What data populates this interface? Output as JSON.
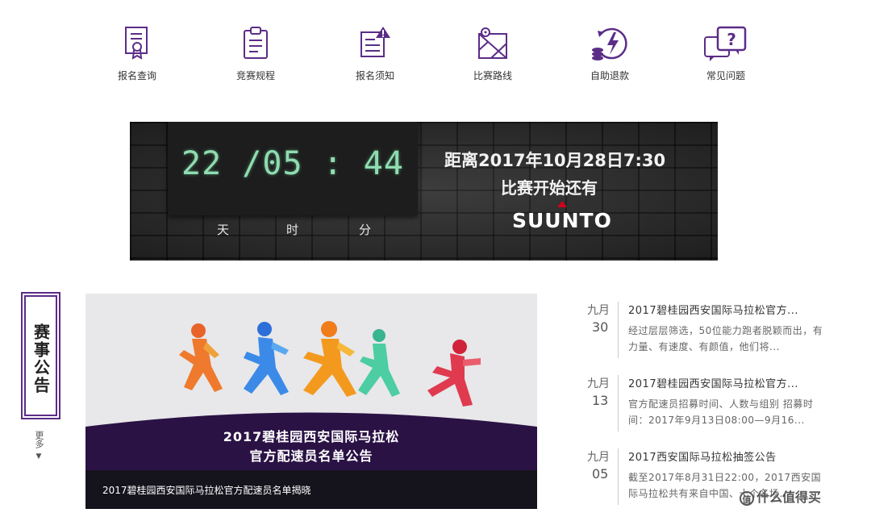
{
  "nav": {
    "items": [
      {
        "label": "报名查询",
        "icon": "certificate-icon"
      },
      {
        "label": "竞赛规程",
        "icon": "clipboard-icon"
      },
      {
        "label": "报名须知",
        "icon": "notice-alert-icon"
      },
      {
        "label": "比赛路线",
        "icon": "route-map-icon"
      },
      {
        "label": "自助退款",
        "icon": "refund-coins-icon"
      },
      {
        "label": "常见问题",
        "icon": "question-bubble-icon"
      }
    ],
    "icon_color": "#5b2d87"
  },
  "countdown": {
    "time": "22 /05 : 44",
    "units": [
      "天",
      "时",
      "分"
    ],
    "line1": "距离2017年10月28日7:30",
    "line2": "比赛开始还有",
    "brand": "SUUNTO",
    "digit_color": "#8fdcb0"
  },
  "sidebar": {
    "title": "赛事公告",
    "more": "更多"
  },
  "feature": {
    "title_line1": "2017碧桂园西安国际马拉松",
    "title_line2": "官方配速员名单公告",
    "caption": "2017碧桂园西安国际马拉松官方配速员名单揭晓"
  },
  "news": [
    {
      "month": "九月",
      "day": "30",
      "title": "2017碧桂园西安国际马拉松官方...",
      "summary": "经过层层筛选，50位能力跑者脱颖而出，有力量、有速度、有颜值，他们将..."
    },
    {
      "month": "九月",
      "day": "13",
      "title": "2017碧桂园西安国际马拉松官方...",
      "summary": "官方配速员招募时间、人数与组别 招募时间：2017年9月13日08:00—9月16..."
    },
    {
      "month": "九月",
      "day": "05",
      "title": "2017西安国际马拉松抽签公告",
      "summary": "截至2017年8月31日22:00，2017西安国际马拉松共有来自中国、十个名场..."
    }
  ],
  "watermark": {
    "badge": "值",
    "text": "什么值得买"
  }
}
